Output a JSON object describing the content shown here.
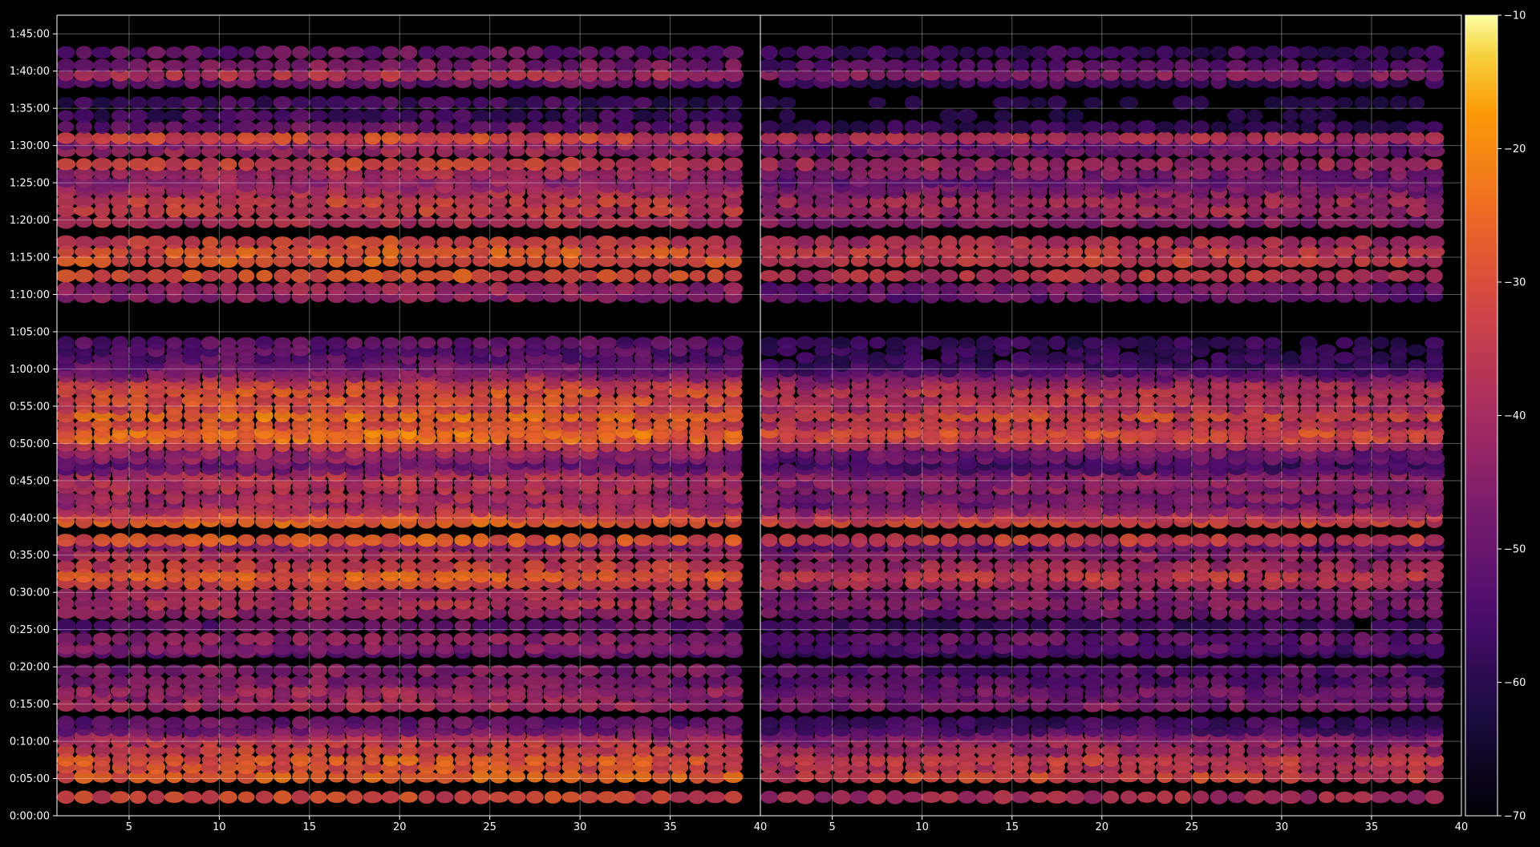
{
  "chart_data": {
    "type": "heatmap",
    "title": "",
    "colormap": "inferno",
    "background": "#000000",
    "grid": true,
    "panels": [
      {
        "name": "",
        "x_ticks": [
          5,
          10,
          15,
          20,
          25,
          30,
          35
        ],
        "x_end_label": "40",
        "xlim": [
          1,
          40
        ]
      },
      {
        "name": "",
        "x_ticks": [
          5,
          10,
          15,
          20,
          25,
          30,
          35
        ],
        "x_end_label": "40",
        "xlim": [
          1,
          40
        ]
      }
    ],
    "y_tick_labels": [
      "0:00:00",
      "0:05:00",
      "0:10:00",
      "0:15:00",
      "0:20:00",
      "0:25:00",
      "0:30:00",
      "0:35:00",
      "0:40:00",
      "0:45:00",
      "0:50:00",
      "0:55:00",
      "1:00:00",
      "1:05:00",
      "1:10:00",
      "1:15:00",
      "1:20:00",
      "1:25:00",
      "1:30:00",
      "1:35:00",
      "1:40:00",
      "1:45:00"
    ],
    "ylim_seconds": [
      0,
      6450
    ],
    "colorbar": {
      "ticks": [
        -10,
        -20,
        -30,
        -40,
        -50,
        -60,
        -70
      ],
      "range": [
        -70,
        -10
      ]
    },
    "bands_seconds_db": [
      [
        150,
        -34
      ],
      [
        315,
        -28
      ],
      [
        390,
        -32
      ],
      [
        450,
        -30
      ],
      [
        525,
        -36
      ],
      [
        600,
        -38
      ],
      [
        645,
        -42
      ],
      [
        690,
        -50
      ],
      [
        750,
        -52
      ],
      [
        885,
        -42
      ],
      [
        960,
        -44
      ],
      [
        1005,
        -44
      ],
      [
        1080,
        -48
      ],
      [
        1170,
        -48
      ],
      [
        1320,
        -52
      ],
      [
        1350,
        -48
      ],
      [
        1425,
        -46
      ],
      [
        1530,
        -52
      ],
      [
        1635,
        -44
      ],
      [
        1710,
        -40
      ],
      [
        1785,
        -42
      ],
      [
        1875,
        -34
      ],
      [
        1935,
        -30
      ],
      [
        2010,
        -36
      ],
      [
        2100,
        -40
      ],
      [
        2175,
        -46
      ],
      [
        2220,
        -30
      ],
      [
        2370,
        -28
      ],
      [
        2415,
        -32
      ],
      [
        2460,
        -40
      ],
      [
        2520,
        -44
      ],
      [
        2565,
        -42
      ],
      [
        2640,
        -40
      ],
      [
        2685,
        -40
      ],
      [
        2745,
        -40
      ],
      [
        2790,
        -50
      ],
      [
        2835,
        -52
      ],
      [
        2880,
        -46
      ],
      [
        2925,
        -44
      ],
      [
        2985,
        -36
      ],
      [
        3045,
        -28
      ],
      [
        3090,
        -26
      ],
      [
        3150,
        -32
      ],
      [
        3225,
        -26
      ],
      [
        3285,
        -34
      ],
      [
        3345,
        -32
      ],
      [
        3420,
        -32
      ],
      [
        3480,
        -36
      ],
      [
        3540,
        -44
      ],
      [
        3585,
        -50
      ],
      [
        3630,
        -52
      ],
      [
        3690,
        -54
      ],
      [
        3750,
        -54
      ],
      [
        3810,
        -54
      ],
      [
        4185,
        -46
      ],
      [
        4245,
        -44
      ],
      [
        4350,
        -32
      ],
      [
        4470,
        -30
      ],
      [
        4545,
        -30
      ],
      [
        4620,
        -34
      ],
      [
        4785,
        -40
      ],
      [
        4875,
        -36
      ],
      [
        4950,
        -36
      ],
      [
        5025,
        -40
      ],
      [
        5070,
        -44
      ],
      [
        5115,
        -46
      ],
      [
        5175,
        -42
      ],
      [
        5250,
        -36
      ],
      [
        5355,
        -44
      ],
      [
        5415,
        -46
      ],
      [
        5460,
        -34
      ],
      [
        5550,
        -52
      ],
      [
        5640,
        -58
      ],
      [
        5745,
        -58
      ],
      [
        5910,
        -52
      ],
      [
        5970,
        -40
      ],
      [
        6045,
        -48
      ],
      [
        6150,
        -52
      ]
    ]
  },
  "colors": {
    "grid": "rgba(255,255,255,0.35)",
    "frame": "#ffffff"
  }
}
